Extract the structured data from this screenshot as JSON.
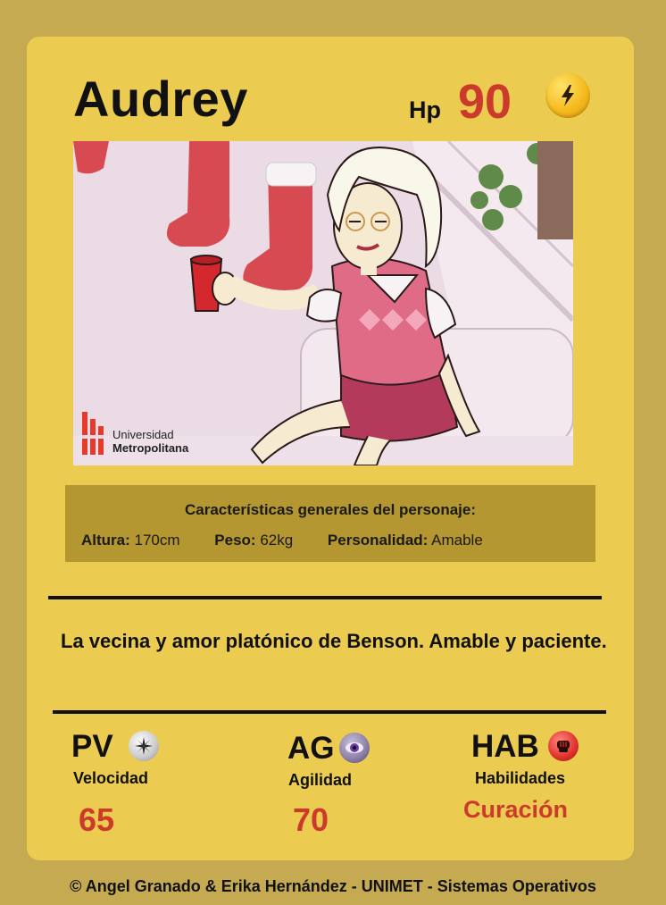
{
  "card": {
    "name": "Audrey",
    "hp_label": "Hp",
    "hp_value": "90",
    "hp_icon": "lightning-icon",
    "portrait": {
      "logo_line1": "Universidad",
      "logo_line2": "Metropolitana"
    },
    "characteristics": {
      "title": "Características generales del personaje:",
      "height_label": "Altura:",
      "height_value": "170cm",
      "weight_label": "Peso:",
      "weight_value": "62kg",
      "personality_label": "Personalidad:",
      "personality_value": "Amable"
    },
    "description": "La vecina y amor platónico de Benson. Amable y paciente.",
    "stats": [
      {
        "code": "PV",
        "name": "Velocidad",
        "value": "65",
        "icon": "compass-icon"
      },
      {
        "code": "AG",
        "name": "Agilidad",
        "value": "70",
        "icon": "eye-icon"
      },
      {
        "code": "HAB",
        "name": "Habilidades",
        "value": "Curación",
        "icon": "fist-icon"
      }
    ]
  },
  "footer": "© Angel Granado & Erika Hernández - UNIMET - Sistemas Operativos",
  "colors": {
    "background": "#c5aa52",
    "card": "#ebcb50",
    "stats_box": "#b49730",
    "accent_red": "#cc3a2b"
  }
}
